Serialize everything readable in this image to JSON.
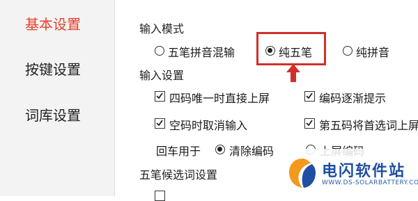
{
  "sidebar": {
    "items": [
      {
        "label": "基本设置",
        "active": true
      },
      {
        "label": "按键设置",
        "active": false
      },
      {
        "label": "词库设置",
        "active": false
      }
    ]
  },
  "input_mode": {
    "title": "输入模式",
    "options": [
      {
        "label": "五笔拼音混输",
        "selected": false
      },
      {
        "label": "纯五笔",
        "selected": true
      },
      {
        "label": "纯拼音",
        "selected": false
      }
    ]
  },
  "input_settings": {
    "title": "输入设置",
    "checkboxes": [
      {
        "label": "四码唯一时直接上屏",
        "checked": true
      },
      {
        "label": "编码逐渐提示",
        "checked": true
      },
      {
        "label": "空码时取消输入",
        "checked": true
      },
      {
        "label": "第五码将首选词上屏",
        "checked": true
      }
    ],
    "enter_key": {
      "label": "回车用于",
      "options": [
        {
          "label": "清除编码",
          "selected": true
        },
        {
          "label": "上屏编码",
          "selected": false
        }
      ]
    }
  },
  "candidate_settings": {
    "title": "五笔候选词设置"
  },
  "watermark": {
    "brand": "电闪软件站",
    "url": "WWW.DS-SOLARBATTERY.COM"
  },
  "colors": {
    "accent": "#e8402b",
    "highlight_box": "#d0302a",
    "brand_blue": "#1e4fa3",
    "brand_orange": "#f39a1e"
  }
}
